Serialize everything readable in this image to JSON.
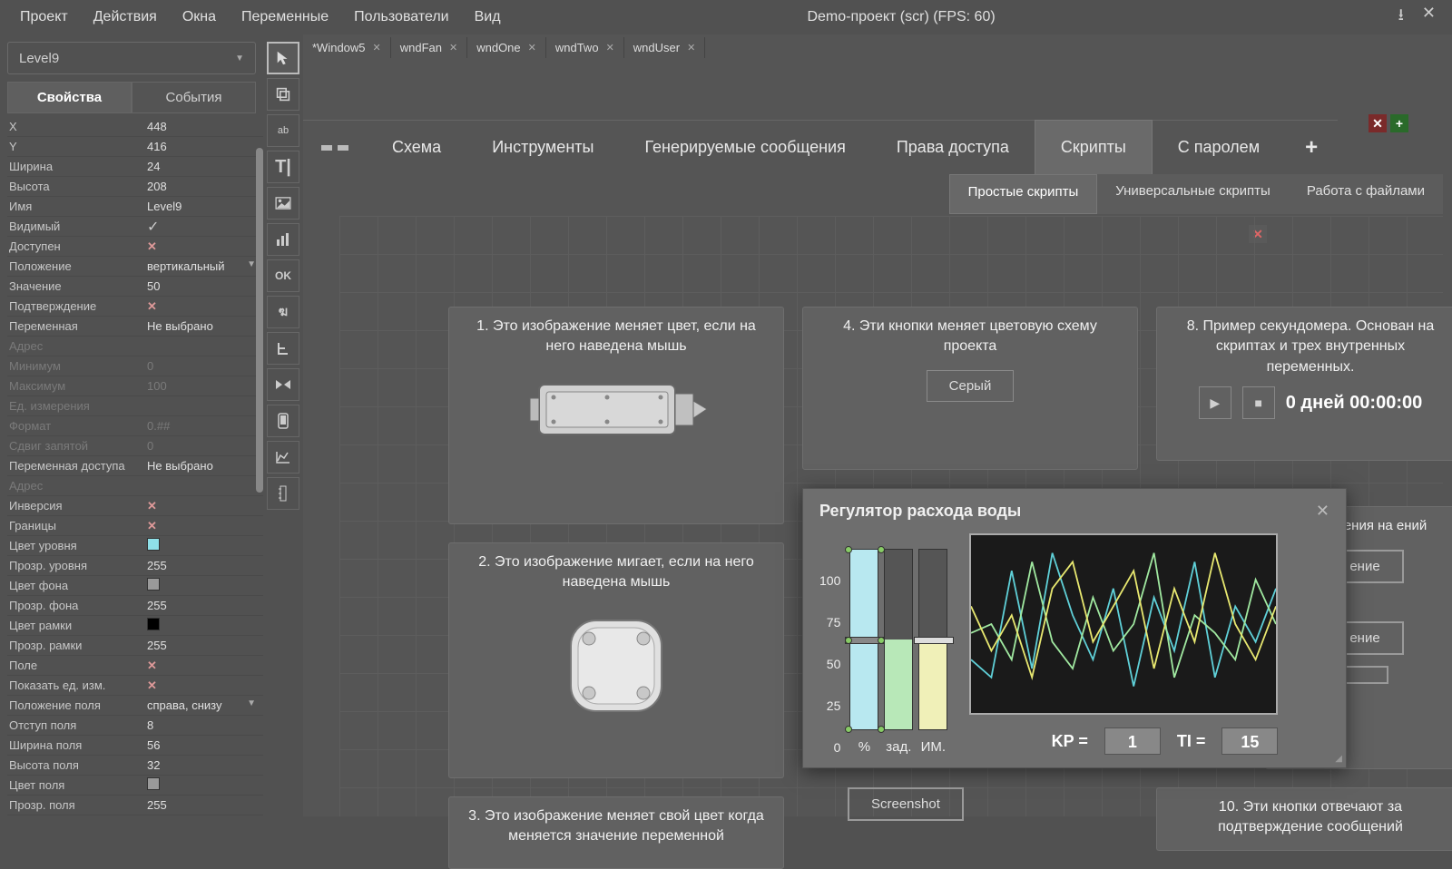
{
  "menubar": [
    "Проект",
    "Действия",
    "Окна",
    "Переменные",
    "Пользователи",
    "Вид"
  ],
  "title": "Demo-проект (scr)  (FPS: 60)",
  "selector": "Level9",
  "pe_tabs": {
    "props": "Свойства",
    "events": "События"
  },
  "properties": [
    {
      "k": "X",
      "v": "448"
    },
    {
      "k": "Y",
      "v": "416"
    },
    {
      "k": "Ширина",
      "v": "24"
    },
    {
      "k": "Высота",
      "v": "208"
    },
    {
      "k": "Имя",
      "v": "Level9"
    },
    {
      "k": "Видимый",
      "v": "✓",
      "check": true
    },
    {
      "k": "Доступен",
      "v": "✕",
      "xmark": true
    },
    {
      "k": "Положение",
      "v": "вертикальный",
      "dd": true
    },
    {
      "k": "Значение",
      "v": "50"
    },
    {
      "k": "Подтверждение",
      "v": "✕",
      "xmark": true
    },
    {
      "k": "Переменная",
      "v": "Не выбрано"
    },
    {
      "k": "Адрес",
      "v": "",
      "disabled": true
    },
    {
      "k": "Минимум",
      "v": "0",
      "disabled": true
    },
    {
      "k": "Максимум",
      "v": "100",
      "disabled": true
    },
    {
      "k": "Ед. измерения",
      "v": "",
      "disabled": true
    },
    {
      "k": "Формат",
      "v": "0.##",
      "disabled": true
    },
    {
      "k": "Сдвиг запятой",
      "v": "0",
      "disabled": true
    },
    {
      "k": "Переменная доступа",
      "v": "Не выбрано"
    },
    {
      "k": "Адрес",
      "v": "",
      "disabled": true
    },
    {
      "k": "Инверсия",
      "v": "✕",
      "xmark": true
    },
    {
      "k": "Границы",
      "v": "✕",
      "xmark": true
    },
    {
      "k": "Цвет уровня",
      "swatch": "#8fe0e8"
    },
    {
      "k": "Прозр. уровня",
      "v": "255"
    },
    {
      "k": "Цвет фона",
      "swatch": "#9a9a9a"
    },
    {
      "k": "Прозр. фона",
      "v": "255"
    },
    {
      "k": "Цвет рамки",
      "swatch": "#000000"
    },
    {
      "k": "Прозр. рамки",
      "v": "255"
    },
    {
      "k": "Поле",
      "v": "✕",
      "xmark": true
    },
    {
      "k": "Показать ед. изм.",
      "v": "✕",
      "xmark": true
    },
    {
      "k": "Положение поля",
      "v": "справа, снизу",
      "dd": true
    },
    {
      "k": "Отступ поля",
      "v": "8"
    },
    {
      "k": "Ширина поля",
      "v": "56"
    },
    {
      "k": "Высота поля",
      "v": "32"
    },
    {
      "k": "Цвет поля",
      "swatch": "#9a9a9a"
    },
    {
      "k": "Прозр. поля",
      "v": "255"
    }
  ],
  "tools": [
    "cursor",
    "copy",
    "ab",
    "T",
    "image",
    "bars",
    "OK",
    "sub",
    "branch",
    "bowtie",
    "phone",
    "chart",
    "level"
  ],
  "file_tabs": [
    "*Window5",
    "wndFan",
    "wndOne",
    "wndTwo",
    "wndUser"
  ],
  "big_tabs": [
    "Схема",
    "Инструменты",
    "Генерируемые сообщения",
    "Права доступа",
    "Скрипты",
    "С паролем"
  ],
  "sub_tabs": [
    "Простые скрипты",
    "Универсальные скрипты",
    "Работа с файлами"
  ],
  "cards": {
    "c1": "1. Это изображение меняет цвет, если на него наведена мышь",
    "c2": "2. Это изображение мигает, если на него наведена мышь",
    "c3": "3. Это изображение меняет свой цвет когда меняется значение переменной",
    "c4": "4. Эти кнопки меняет цветовую схему проекта",
    "c4_btn": "Серый",
    "c8": "8. Пример секундомера. Основан на скриптах и трех внутренных переменных.",
    "c8_time": "0 дней 00:00:00",
    "c9a": "сообщения на\nений",
    "c9b": "ение",
    "c9c": "ение",
    "c10": "10. Эти кнопки отвечают за подтверждение сообщений",
    "screenshot": "Screenshot"
  },
  "dialog": {
    "title": "Регулятор расхода воды",
    "scale": [
      "100",
      "75",
      "50",
      "25",
      "0"
    ],
    "labels": [
      "%",
      "зад.",
      "ИМ."
    ],
    "kp_label": "KP =",
    "kp_val": "1",
    "ti_label": "TI =",
    "ti_val": "15"
  },
  "chart_data": {
    "type": "line",
    "title": "Регулятор расхода воды",
    "xlabel": "",
    "ylabel": "%",
    "ylim": [
      0,
      100
    ],
    "x": [
      0,
      1,
      2,
      3,
      4,
      5,
      6,
      7,
      8,
      9,
      10,
      11,
      12,
      13,
      14,
      15
    ],
    "series": [
      {
        "name": "%",
        "color": "#5fd0d8",
        "values": [
          30,
          20,
          80,
          25,
          90,
          55,
          30,
          70,
          15,
          65,
          35,
          85,
          20,
          60,
          40,
          70
        ]
      },
      {
        "name": "зад.",
        "color": "#a0e8a0",
        "values": [
          45,
          50,
          30,
          85,
          40,
          25,
          65,
          35,
          50,
          90,
          20,
          55,
          45,
          30,
          75,
          50
        ]
      },
      {
        "name": "ИМ.",
        "color": "#e8e870",
        "values": [
          60,
          35,
          55,
          20,
          70,
          85,
          40,
          60,
          80,
          25,
          70,
          40,
          90,
          50,
          30,
          60
        ]
      }
    ],
    "levels": {
      "%": 100,
      "зад.": 50,
      "ИМ.": 50
    }
  }
}
